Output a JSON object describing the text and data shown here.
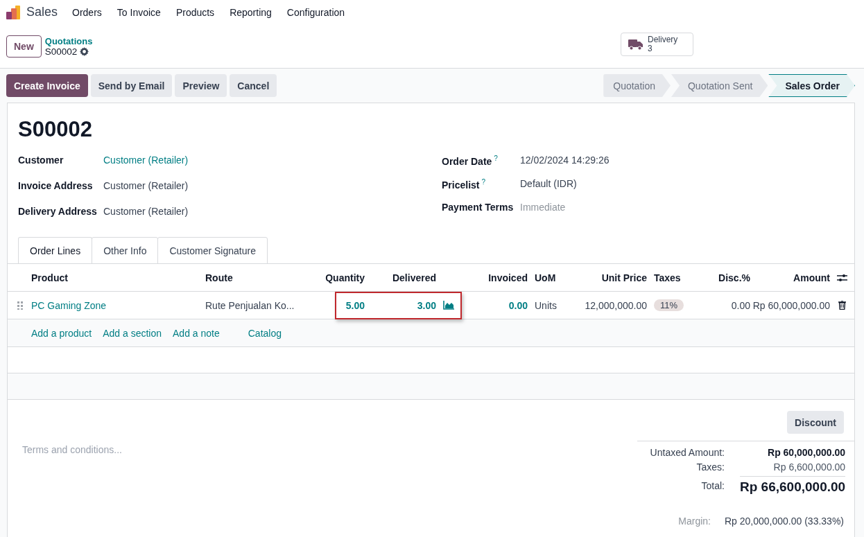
{
  "navbar": {
    "app": "Sales",
    "menu": [
      "Orders",
      "To Invoice",
      "Products",
      "Reporting",
      "Configuration"
    ]
  },
  "control_panel": {
    "new_button": "New",
    "breadcrumb": "Quotations",
    "record": "S00002",
    "smart_button": {
      "label": "Delivery",
      "count": "3"
    }
  },
  "actions": [
    {
      "label": "Create Invoice",
      "primary": true
    },
    {
      "label": "Send by Email",
      "primary": false
    },
    {
      "label": "Preview",
      "primary": false
    },
    {
      "label": "Cancel",
      "primary": false
    }
  ],
  "stages": [
    {
      "label": "Quotation",
      "selected": false
    },
    {
      "label": "Quotation Sent",
      "selected": false
    },
    {
      "label": "Sales Order",
      "selected": true
    }
  ],
  "form": {
    "title": "S00002",
    "left_fields": [
      {
        "label": "Customer",
        "value": "Customer (Retailer)",
        "kind": "link"
      },
      {
        "label": "Invoice Address",
        "value": "Customer (Retailer)",
        "kind": "text"
      },
      {
        "label": "Delivery Address",
        "value": "Customer (Retailer)",
        "kind": "text"
      }
    ],
    "right_fields": [
      {
        "label": "Order Date",
        "help": "?",
        "value": "12/02/2024 14:29:26",
        "kind": "text"
      },
      {
        "label": "Pricelist",
        "help": "?",
        "value": "Default (IDR)",
        "kind": "text"
      },
      {
        "label": "Payment Terms",
        "placeholder": "Immediate",
        "kind": "empty"
      }
    ],
    "tabs": [
      {
        "label": "Order Lines",
        "selected": true
      },
      {
        "label": "Other Info",
        "selected": false
      },
      {
        "label": "Customer Signature",
        "selected": false
      }
    ],
    "table": {
      "columns": [
        "Product",
        "Route",
        "Quantity",
        "Delivered",
        "Invoiced",
        "UoM",
        "Unit Price",
        "Taxes",
        "Disc.%",
        "Amount"
      ],
      "rows": [
        {
          "product": "PC Gaming Zone",
          "route": "Rute Penjualan Ko...",
          "quantity": "5.00",
          "delivered": "3.00",
          "invoiced": "0.00",
          "uom": "Units",
          "unit_price": "12,000,000.00",
          "taxes": "11%",
          "discount": "0.00",
          "amount": "Rp 60,000,000.00"
        }
      ],
      "add_links": [
        "Add a product",
        "Add a section",
        "Add a note",
        "Catalog"
      ]
    },
    "terms_placeholder": "Terms and conditions...",
    "discount_button": "Discount",
    "totals": [
      {
        "label": "Untaxed Amount:",
        "value": "Rp 60,000,000.00",
        "kind": "strong"
      },
      {
        "label": "Taxes:",
        "value": "Rp 6,600,000.00",
        "kind": "plain"
      },
      {
        "label": "Total:",
        "value": "Rp 66,600,000.00",
        "kind": "total"
      }
    ],
    "margin": {
      "label": "Margin:",
      "value": "Rp 20,000,000.00 (33.33%)"
    }
  }
}
